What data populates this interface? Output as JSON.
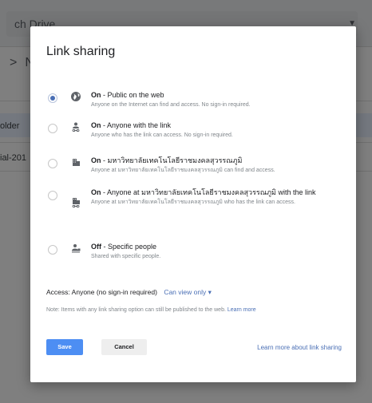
{
  "background": {
    "search_text": "ch Drive",
    "nav_chevron": ">",
    "nav_text": "N",
    "row1_text": "older",
    "row2_text": "ial-201"
  },
  "dialog": {
    "title": "Link sharing",
    "options": [
      {
        "title_bold": "On",
        "title_rest": " - Public on the web",
        "description": "Anyone on the Internet can find and access. No sign-in required.",
        "selected": true,
        "icon": "globe-icon"
      },
      {
        "title_bold": "On",
        "title_rest": " - Anyone with the link",
        "description": "Anyone who has the link can access. No sign-in required.",
        "selected": false,
        "icon": "person-link-icon"
      },
      {
        "title_bold": "On",
        "title_rest": " - มหาวิทยาลัยเทคโนโลยีราชมงคลสุวรรณภูมิ",
        "description": "Anyone at มหาวิทยาลัยเทคโนโลยีราชมงคลสุวรรณภูมิ can find and access.",
        "selected": false,
        "icon": "building-icon"
      },
      {
        "title_bold": "On",
        "title_rest": " - Anyone at มหาวิทยาลัยเทคโนโลยีราชมงคลสุวรรณภูมิ with the link",
        "description": "Anyone at มหาวิทยาลัยเทคโนโลยีราชมงคลสุวรรณภูมิ who has the link can access.",
        "selected": false,
        "icon": "building-link-icon"
      },
      {
        "title_bold": "Off",
        "title_rest": " - Specific people",
        "description": "Shared with specific people.",
        "selected": false,
        "icon": "person-off-icon"
      }
    ],
    "access_label": "Access:",
    "access_value": "Anyone (no sign-in required)",
    "access_permission": "Can view only ▾",
    "note_text": "Note: Items with any link sharing option can still be published to the web.",
    "note_link": "Learn more",
    "save_label": "Save",
    "cancel_label": "Cancel",
    "learn_more_label": "Learn more about link sharing"
  },
  "colors": {
    "accent": "#4a6fb5",
    "save_button": "#4d8ef3"
  }
}
